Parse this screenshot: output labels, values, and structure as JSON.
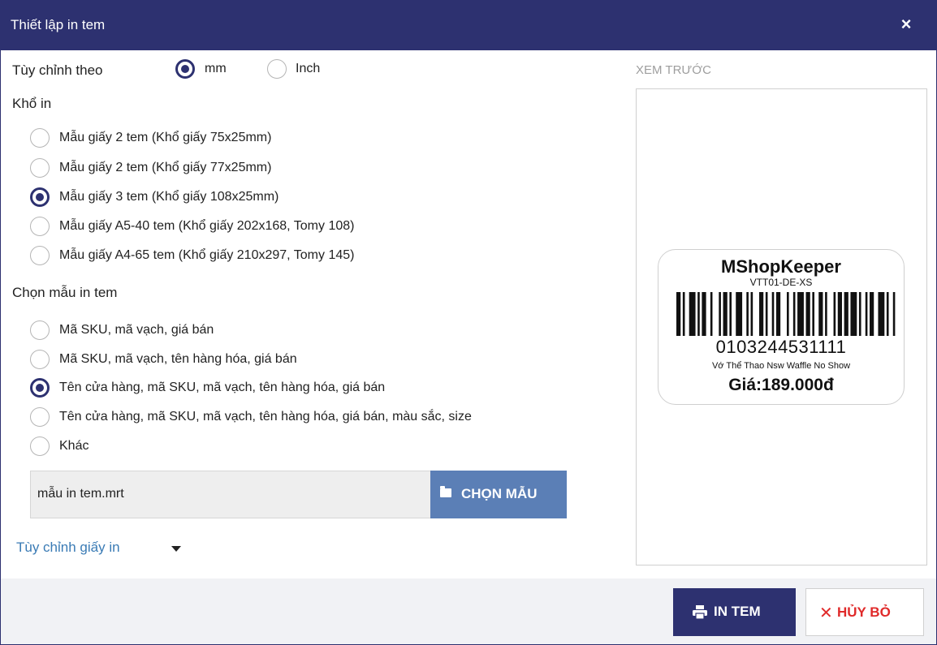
{
  "dialog": {
    "title": "Thiết lập in tem",
    "close_icon": "×"
  },
  "unit": {
    "label": "Tùy chỉnh theo",
    "options": [
      {
        "label": "mm",
        "checked": true
      },
      {
        "label": "Inch",
        "checked": false
      }
    ]
  },
  "paper": {
    "heading": "Khổ in",
    "options": [
      {
        "label": "Mẫu giấy 2 tem (Khổ giấy 75x25mm)",
        "checked": false
      },
      {
        "label": "Mẫu giấy 2 tem (Khổ giấy 77x25mm)",
        "checked": false
      },
      {
        "label": "Mẫu giấy 3 tem (Khổ giấy 108x25mm)",
        "checked": true
      },
      {
        "label": "Mẫu giấy A5-40 tem (Khổ giấy 202x168, Tomy 108)",
        "checked": false
      },
      {
        "label": "Mẫu giấy A4-65 tem (Khổ giấy 210x297, Tomy 145)",
        "checked": false
      }
    ]
  },
  "template": {
    "heading": "Chọn mẫu in tem",
    "options": [
      {
        "label": "Mã SKU, mã vạch, giá bán",
        "checked": false
      },
      {
        "label": "Mã SKU, mã vạch, tên hàng hóa, giá bán",
        "checked": false
      },
      {
        "label": "Tên cửa hàng, mã SKU, mã vạch, tên hàng hóa, giá bán",
        "checked": true
      },
      {
        "label": "Tên cửa hàng, mã SKU, mã vạch, tên hàng hóa, giá bán, màu sắc, size",
        "checked": false
      },
      {
        "label": "Khác",
        "checked": false
      }
    ],
    "file_value": "mẫu in tem.mrt",
    "choose_button": "CHỌN MẪU"
  },
  "custom_paper_link": "Tùy chỉnh giấy in",
  "preview": {
    "heading": "XEM TRƯỚC",
    "shop": "MShopKeeper",
    "sku": "VTT01-DE-XS",
    "barcode": "0103244531111",
    "product_name": "Vớ Thể Thao Nsw Waffle No Show",
    "price": "Giá:189.000đ"
  },
  "footer": {
    "print_button": "IN TEM",
    "cancel_button": "HỦY BỎ",
    "cancel_icon": "✕"
  },
  "colors": {
    "primary": "#2d3170",
    "accent_button": "#5b7fb6",
    "link": "#3a7bb5",
    "danger": "#e02a2a"
  }
}
